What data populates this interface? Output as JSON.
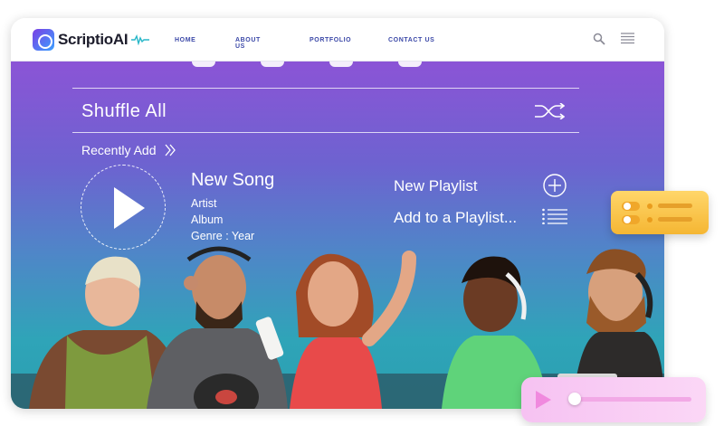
{
  "brand": {
    "name": "ScriptioAI",
    "name_main": "Scriptio",
    "name_accent": "A",
    "accent_color": "#7b3fe4"
  },
  "nav": {
    "links": [
      "HOME",
      "ABOUT US",
      "PORTFOLIO",
      "CONTACT US"
    ],
    "icons": [
      "search-icon",
      "menu-icon"
    ]
  },
  "player": {
    "shuffle_label": "Shuffle All",
    "recent_label": "Recently Add",
    "song": {
      "title": "New Song",
      "artist": "Artist",
      "album": "Album",
      "genre_year": "Genre : Year"
    },
    "actions": {
      "new_playlist": "New Playlist",
      "add_to_playlist": "Add to a Playlist..."
    }
  },
  "mini_player": {
    "progress": 0.05
  },
  "colors": {
    "gradient_top": "#8b54d6",
    "gradient_bottom": "#2a9fb0",
    "nav_link": "#3c49a8",
    "toggle_card": "#f5b633",
    "mini_player": "#f089de"
  }
}
